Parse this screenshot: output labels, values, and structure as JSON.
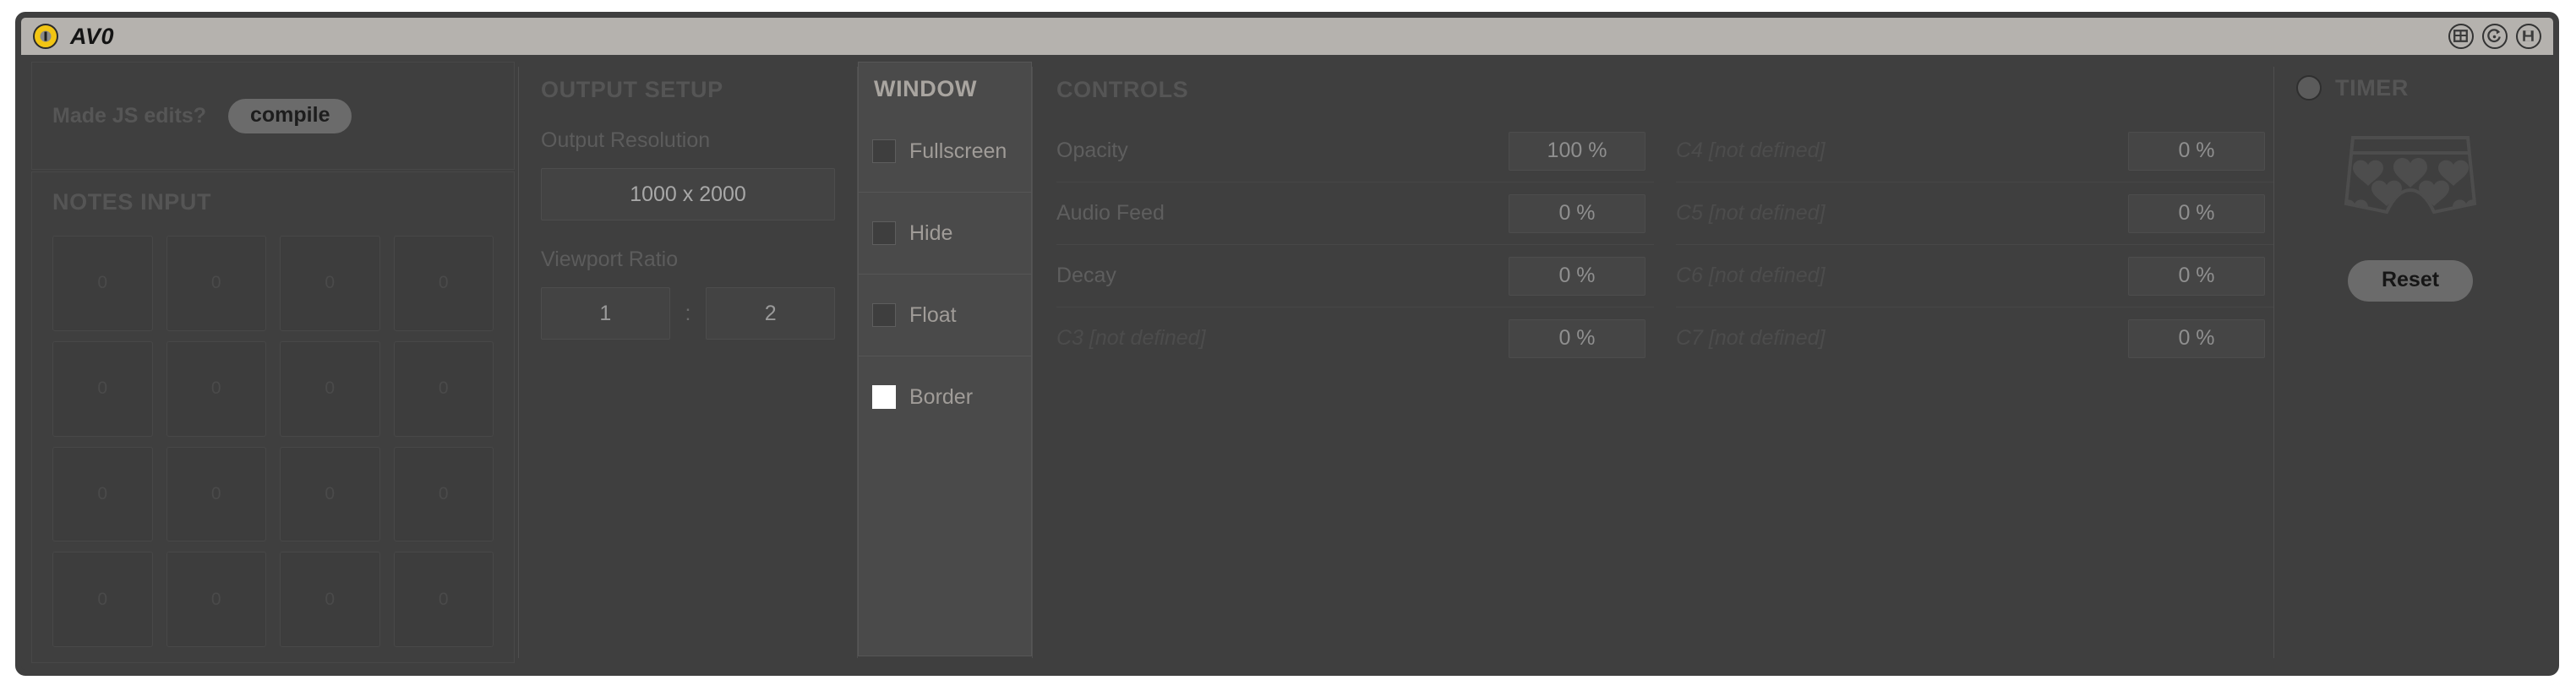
{
  "window": {
    "title": "AV0",
    "mode_icon": "power-indicator-icon",
    "titlebar_icons": [
      "grid-edit-icon",
      "clock-refresh-icon",
      "save-disk-icon"
    ]
  },
  "compile": {
    "question": "Made JS edits?",
    "button_label": "compile"
  },
  "notes_input": {
    "title": "NOTES INPUT",
    "cells": [
      [
        "0",
        "0",
        "0",
        "0"
      ],
      [
        "0",
        "0",
        "0",
        "0"
      ],
      [
        "0",
        "0",
        "0",
        "0"
      ],
      [
        "0",
        "0",
        "0",
        "0"
      ]
    ]
  },
  "output_setup": {
    "title": "OUTPUT SETUP",
    "resolution_label": "Output Resolution",
    "resolution_value": "1000 x 2000",
    "ratio_label": "Viewport Ratio",
    "ratio_width": "1",
    "ratio_separator": ":",
    "ratio_height": "2"
  },
  "window_panel": {
    "title": "WINDOW",
    "options": [
      {
        "label": "Fullscreen",
        "checked": false
      },
      {
        "label": "Hide",
        "checked": false
      },
      {
        "label": "Float",
        "checked": false
      },
      {
        "label": "Border",
        "checked": true
      }
    ]
  },
  "controls": {
    "title": "CONTROLS",
    "left_column": [
      {
        "name": "Opacity",
        "value": "100 %",
        "defined": true
      },
      {
        "name": "Audio Feed",
        "value": "0 %",
        "defined": true
      },
      {
        "name": "Decay",
        "value": "0 %",
        "defined": true
      },
      {
        "name": "C3 [not defined]",
        "value": "0 %",
        "defined": false
      }
    ],
    "right_column": [
      {
        "name": "C4 [not defined]",
        "value": "0 %",
        "defined": false
      },
      {
        "name": "C5 [not defined]",
        "value": "0 %",
        "defined": false
      },
      {
        "name": "C6 [not defined]",
        "value": "0 %",
        "defined": false
      },
      {
        "name": "C7 [not defined]",
        "value": "0 %",
        "defined": false
      }
    ]
  },
  "timer": {
    "title": "TIMER",
    "toggle_state": "off",
    "graphic": "heart-boxer-shorts-icon",
    "reset_label": "Reset"
  },
  "colors": {
    "frame": "#3f3f3f",
    "titlebar": "#b5b2ae",
    "accent_yellow": "#f2c513",
    "panel_active": "#4a4a4a",
    "checkbox_on": "#ffffff",
    "button": "#6b6b6b"
  }
}
